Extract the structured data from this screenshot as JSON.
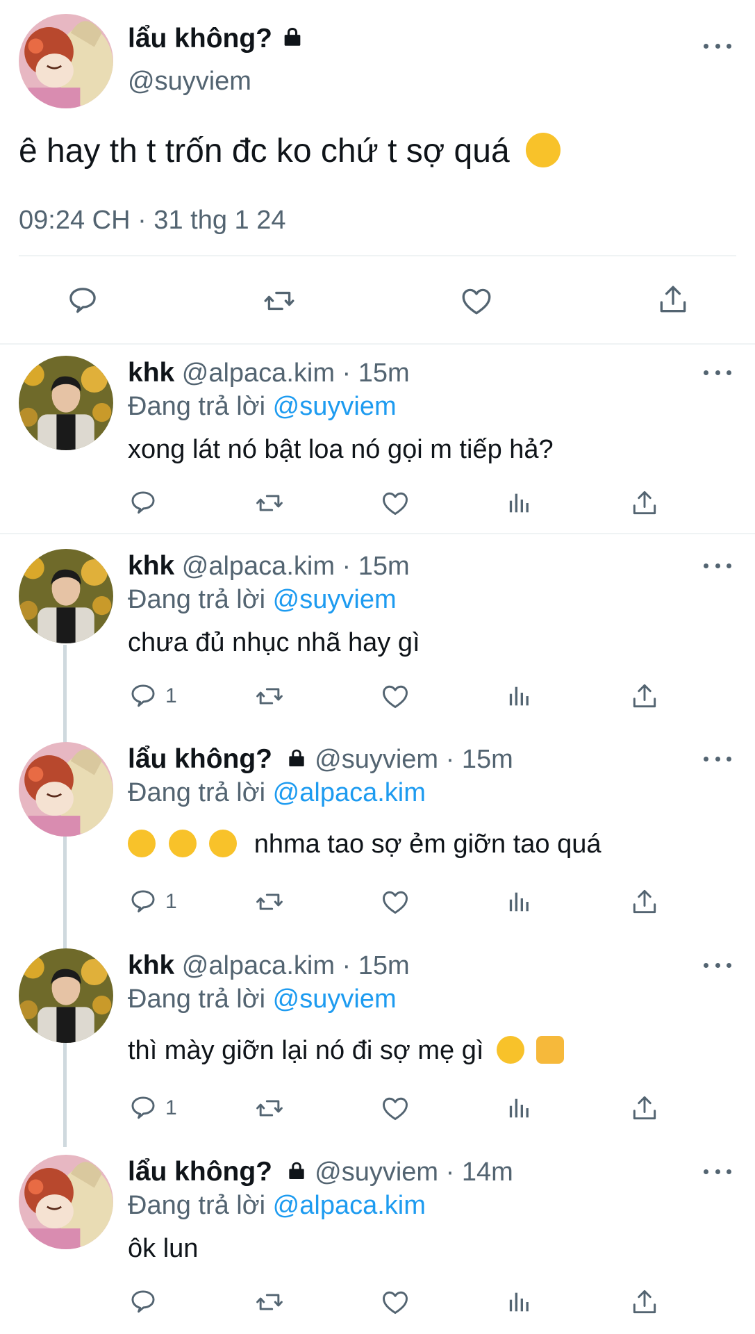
{
  "main_tweet": {
    "display_name": "lẩu không?",
    "handle": "@suyviem",
    "text": "ê hay th t trốn đc ko chứ t sợ quá",
    "text_emoji": "relieved-face-emoji",
    "timestamp": "09:24 CH · 31 thg 1 24",
    "actions": [
      "reply-icon",
      "retweet-icon",
      "like-icon",
      "share-icon"
    ]
  },
  "replies": [
    {
      "display_name": "khk",
      "handle": "@alpaca.kim",
      "time": "· 15m",
      "replying_to_label": "Đang trả lời",
      "replying_to": "@suyviem",
      "text": "xong lát nó bật loa nó gọi m tiếp hả?",
      "reply_count": ""
    },
    {
      "display_name": "khk",
      "handle": "@alpaca.kim",
      "time": "· 15m",
      "replying_to_label": "Đang trả lời",
      "replying_to": "@suyviem",
      "text": "chưa đủ nhục nhã hay gì",
      "reply_count": "1"
    },
    {
      "display_name": "lẩu không?",
      "handle": "@suyviem",
      "time": "· 15m",
      "replying_to_label": "Đang trả lời",
      "replying_to": "@alpaca.kim",
      "text": "nhma tao sợ ẻm giỡn tao quá",
      "reply_count": "1",
      "emojis": [
        "crying-face-emoji",
        "crying-face-emoji",
        "crying-face-emoji"
      ]
    },
    {
      "display_name": "khk",
      "handle": "@alpaca.kim",
      "time": "· 15m",
      "replying_to_label": "Đang trả lời",
      "replying_to": "@suyviem",
      "text": "thì mày giỡn lại nó đi sợ mẹ gì",
      "reply_count": "1",
      "emojis": [
        "smiling-face-with-hearts-emoji",
        "thumbs-up-emoji"
      ]
    },
    {
      "display_name": "lẩu không?",
      "handle": "@suyviem",
      "time": "· 14m",
      "replying_to_label": "Đang trả lời",
      "replying_to": "@alpaca.kim",
      "text": "ôk lun",
      "reply_count": ""
    }
  ],
  "colors": {
    "link_blue": "#1d9bf0",
    "secondary_gray": "#536471",
    "divider": "#eff3f4",
    "text": "#0f1419"
  }
}
